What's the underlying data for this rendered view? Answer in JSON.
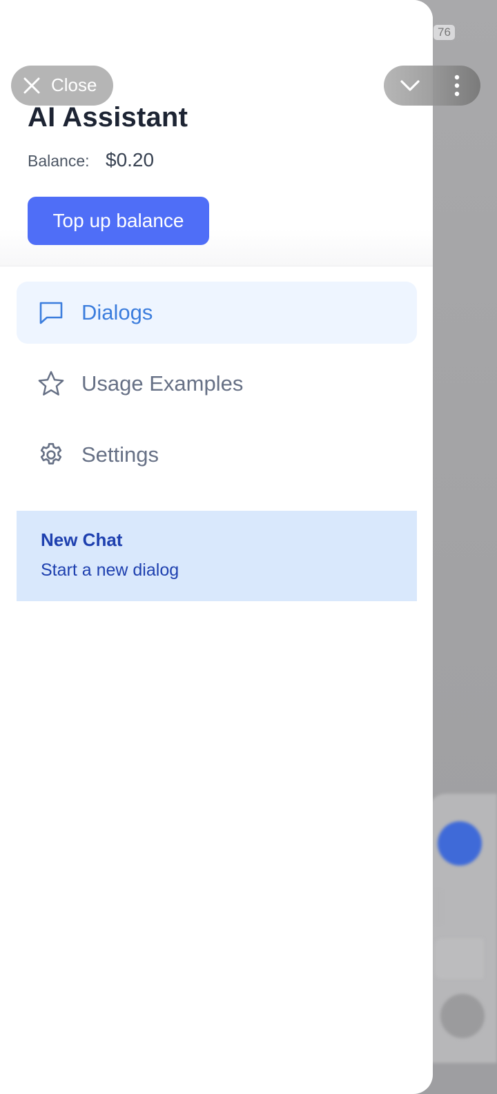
{
  "status_badge": "76",
  "overlay": {
    "close_label": "Close"
  },
  "header": {
    "title": "AI Assistant",
    "balance_label": "Balance:",
    "balance_value": "$0.20",
    "topup_label": "Top up balance"
  },
  "nav": {
    "items": [
      {
        "label": "Dialogs",
        "icon": "message-square-icon",
        "active": true
      },
      {
        "label": "Usage Examples",
        "icon": "star-icon",
        "active": false
      },
      {
        "label": "Settings",
        "icon": "gear-icon",
        "active": false
      }
    ]
  },
  "new_chat": {
    "title": "New Chat",
    "subtitle": "Start a new dialog"
  },
  "colors": {
    "accent": "#4f6ef7",
    "active_nav": "#3b7ddd",
    "active_nav_bg": "#eef5ff",
    "new_chat_bg": "#d9e8fc",
    "new_chat_text": "#1e40af"
  }
}
